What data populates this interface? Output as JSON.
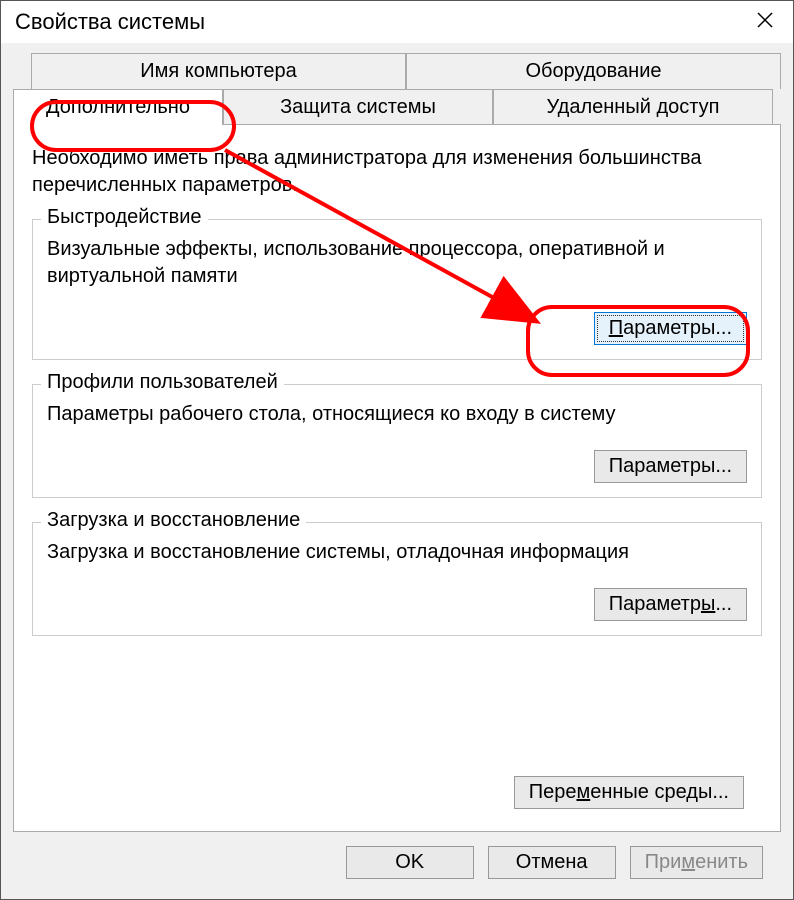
{
  "title": "Свойства системы",
  "tabs": {
    "row1": [
      "Имя компьютера",
      "Оборудование"
    ],
    "row2": {
      "advanced": "Дополнительно",
      "protection": "Защита системы",
      "remote": "Удаленный доступ"
    }
  },
  "info": "Необходимо иметь права администратора для изменения большинства перечисленных параметров.",
  "groups": {
    "perf": {
      "legend": "Быстродействие",
      "desc": "Визуальные эффекты, использование процессора, оперативной и виртуальной памяти",
      "button_pre": "П",
      "button_post": "араметры..."
    },
    "profiles": {
      "legend": "Профили пользователей",
      "desc": "Параметры рабочего стола, относящиеся ко входу в систему",
      "button": "Параметры..."
    },
    "startup": {
      "legend": "Загрузка и восстановление",
      "desc": "Загрузка и восстановление системы, отладочная информация",
      "button_pre": "Параметр",
      "button_u": "ы",
      "button_post": "..."
    }
  },
  "env": {
    "pre": "Пере",
    "u": "м",
    "post": "енные среды..."
  },
  "footer": {
    "ok": "OK",
    "cancel": "Отмена",
    "apply_pre": "При",
    "apply_u": "м",
    "apply_post": "енить"
  }
}
